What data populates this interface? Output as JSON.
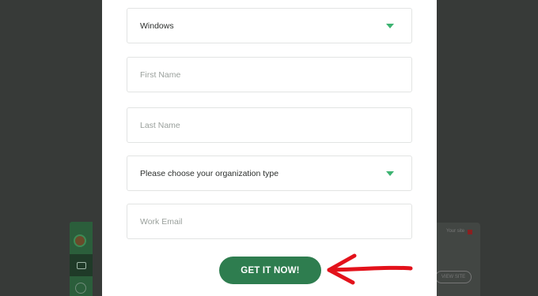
{
  "form": {
    "os_select": {
      "value": "Windows"
    },
    "first_name": {
      "placeholder": "First Name"
    },
    "last_name": {
      "placeholder": "Last Name"
    },
    "org_select": {
      "value": "Please choose your organization type"
    },
    "work_email": {
      "placeholder": "Work Email"
    },
    "submit_label": "GET IT NOW!"
  },
  "background": {
    "your_site_label": "Your site",
    "view_site_label": "VIEW SITE"
  },
  "colors": {
    "accent": "#2e7d4f",
    "caret": "#3cb371",
    "annotation_arrow": "#e3121b",
    "overlay": "#373a38"
  },
  "icons": [
    "chevron-down-icon",
    "briefcase-icon",
    "avatar-icon",
    "red-arrow-icon"
  ]
}
